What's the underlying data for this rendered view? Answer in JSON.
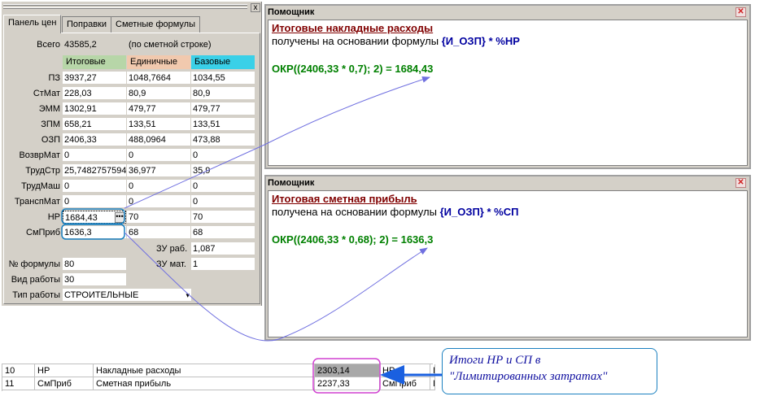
{
  "panel": {
    "close_glyph": "x",
    "tabs": [
      "Панель цен",
      "Поправки",
      "Сметные формулы"
    ],
    "total_label": "Всего",
    "total_value": "43585,2",
    "total_note": "(по сметной строке)",
    "columns": [
      "Итоговые",
      "Единичные",
      "Базовые"
    ],
    "rows": [
      {
        "label": "ПЗ",
        "itog": "3937,27",
        "ed": "1048,7664",
        "baz": "1034,55"
      },
      {
        "label": "СтМат",
        "itog": "228,03",
        "ed": "80,9",
        "baz": "80,9"
      },
      {
        "label": "ЭММ",
        "itog": "1302,91",
        "ed": "479,77",
        "baz": "479,77"
      },
      {
        "label": "ЗПМ",
        "itog": "658,21",
        "ed": "133,51",
        "baz": "133,51"
      },
      {
        "label": "ОЗП",
        "itog": "2406,33",
        "ed": "488,0964",
        "baz": "473,88"
      },
      {
        "label": "ВозврМат",
        "itog": "0",
        "ed": "0",
        "baz": "0"
      },
      {
        "label": "ТрудСтр",
        "itog": "25,7482757594",
        "ed": "36,977",
        "baz": "35,9"
      },
      {
        "label": "ТрудМаш",
        "itog": "0",
        "ed": "0",
        "baz": "0"
      },
      {
        "label": "ТранспМат",
        "itog": "0",
        "ed": "0",
        "baz": "0"
      },
      {
        "label": "НР",
        "itog": "1684,43",
        "ed": "70",
        "baz": "70"
      },
      {
        "label": "СмПриб",
        "itog": "1636,3",
        "ed": "68",
        "baz": "68"
      }
    ],
    "dots_glyph": "•••",
    "zu_rab_label": "ЗУ раб.",
    "zu_rab_value": "1,087",
    "zu_mat_label": "ЗУ мат.",
    "zu_mat_value": "1",
    "formula_no_label": "№ формулы",
    "formula_no_value": "80",
    "work_kind_label": "Вид работы",
    "work_kind_value": "30",
    "work_type_label": "Тип работы",
    "work_type_value": "СТРОИТЕЛЬНЫЕ",
    "dropdown_glyph": "▾"
  },
  "assistant1": {
    "title": "Помощник",
    "close_glyph": "✕",
    "heading": "Итоговые накладные расходы",
    "basis_text": "получены на основании формулы",
    "formula": "{И_ОЗП} * %НР",
    "calc": "ОКР((2406,33 * 0,7); 2) = 1684,43"
  },
  "assistant2": {
    "title": "Помощник",
    "close_glyph": "✕",
    "heading": "Итоговая сметная прибыль",
    "basis_text": "получена на основании формулы",
    "formula": "{И_ОЗП} * %СП",
    "calc": "ОКР((2406,33 * 0,68); 2) = 1636,3"
  },
  "bottom_table": {
    "rows": [
      {
        "num": "10",
        "code": "НР",
        "name": "Накладные расходы",
        "value": "2303,14",
        "code2": "НР",
        "extra": "I"
      },
      {
        "num": "11",
        "code": "СмПриб",
        "name": "Сметная прибыль",
        "value": "2237,33",
        "code2": "СмПриб",
        "extra": "I"
      }
    ]
  },
  "callout": {
    "line1": "Итоги НР и СП в",
    "line2": "\"Лимитированных затратах\""
  },
  "colors": {
    "heading": "#800000",
    "formula": "#0000a0",
    "calc": "#008000",
    "highlight_blue": "#1a80c0",
    "highlight_magenta": "#d040d0",
    "arrow": "#7070e0"
  }
}
